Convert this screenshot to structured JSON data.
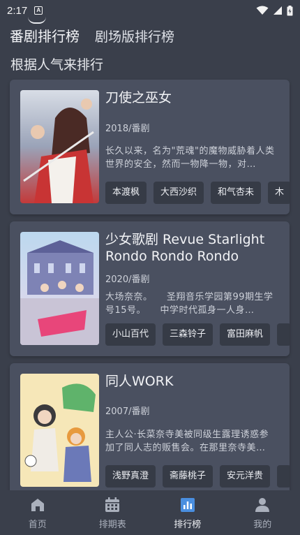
{
  "status": {
    "time": "2:17",
    "notif_glyph": "A"
  },
  "tabs": [
    {
      "label": "番剧排行榜",
      "active": true
    },
    {
      "label": "剧场版排行榜",
      "active": false
    }
  ],
  "subtitle": "根据人气来排行",
  "cards": [
    {
      "title": "刀使之巫女",
      "meta": "2018/番剧",
      "description": "长久以来，名为\"荒魂\"的魔物威胁着人类世界的安全，然而一物降一物，对…",
      "cast": [
        "本渡枫",
        "大西沙织",
        "和气杏未",
        "木"
      ]
    },
    {
      "title": "少女歌剧 Revue Starlight Rondo Rondo Rondo",
      "meta": "2020/番剧",
      "description": "大场奈奈。　　圣翔音乐学园第99期生学号15号。　　中学时代孤身一人身…",
      "cast": [
        "小山百代",
        "三森铃子",
        "富田麻帆",
        ""
      ]
    },
    {
      "title": "同人WORK",
      "meta": "2007/番剧",
      "description": "主人公·长菜奈寺美被同级生露理诱惑参加了同人志的贩售会。在那里奈寺美…",
      "cast": [
        "浅野真澄",
        "斋藤桃子",
        "安元洋贵",
        ""
      ]
    }
  ],
  "nav": [
    {
      "label": "首页",
      "icon": "home-icon",
      "active": false
    },
    {
      "label": "排期表",
      "icon": "calendar-icon",
      "active": false
    },
    {
      "label": "排行榜",
      "icon": "ranking-icon",
      "active": true
    },
    {
      "label": "我的",
      "icon": "profile-icon",
      "active": false
    }
  ],
  "colors": {
    "background": "#3a3f4b",
    "card": "#4a5060",
    "chip": "#363b46",
    "accent": "#4a8fe0"
  }
}
